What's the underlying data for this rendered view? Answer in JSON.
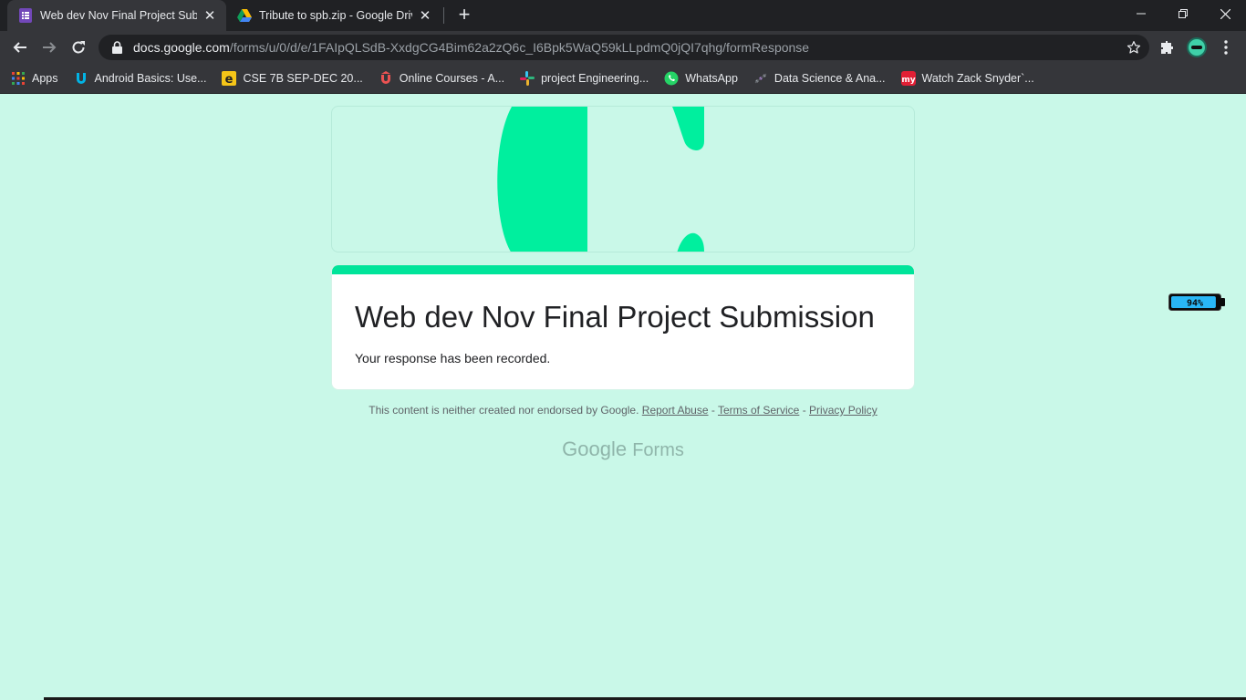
{
  "browser": {
    "tabs": [
      {
        "title": "Web dev Nov Final Project Subm",
        "favicon": "google-forms-icon",
        "active": true
      },
      {
        "title": "Tribute to spb.zip - Google Drive",
        "favicon": "google-drive-icon",
        "active": false
      }
    ],
    "url_host": "docs.google.com",
    "url_path": "/forms/u/0/d/e/1FAIpQLSdB-XxdgCG4Bim62a2zQ6c_I6Bpk5WaQ59kLLpdmQ0jQI7qhg/formResponse",
    "bookmarks": [
      {
        "label": "Apps",
        "icon": "apps-grid-icon"
      },
      {
        "label": "Android Basics: Use...",
        "icon": "udacity-icon"
      },
      {
        "label": "CSE 7B SEP-DEC 20...",
        "icon": "edmodo-icon"
      },
      {
        "label": "Online Courses - A...",
        "icon": "udemy-icon"
      },
      {
        "label": "project Engineering...",
        "icon": "slack-icon"
      },
      {
        "label": "WhatsApp",
        "icon": "whatsapp-icon"
      },
      {
        "label": "Data Science & Ana...",
        "icon": "data-science-icon"
      },
      {
        "label": "Watch Zack Snyder`...",
        "icon": "my-icon"
      }
    ]
  },
  "form": {
    "title": "Web dev Nov Final Project Submission",
    "message": "Your response has been recorded.",
    "accent_color": "#00e49a",
    "background_color": "#c9f8e8"
  },
  "footer": {
    "disclaimer": "This content is neither created nor endorsed by Google.",
    "report_abuse": "Report Abuse",
    "terms": "Terms of Service",
    "privacy": "Privacy Policy",
    "sep": "-",
    "brand_google": "Google",
    "brand_forms": "Forms"
  },
  "widget": {
    "battery_percent_label": "94%",
    "battery_level": 0.94
  }
}
